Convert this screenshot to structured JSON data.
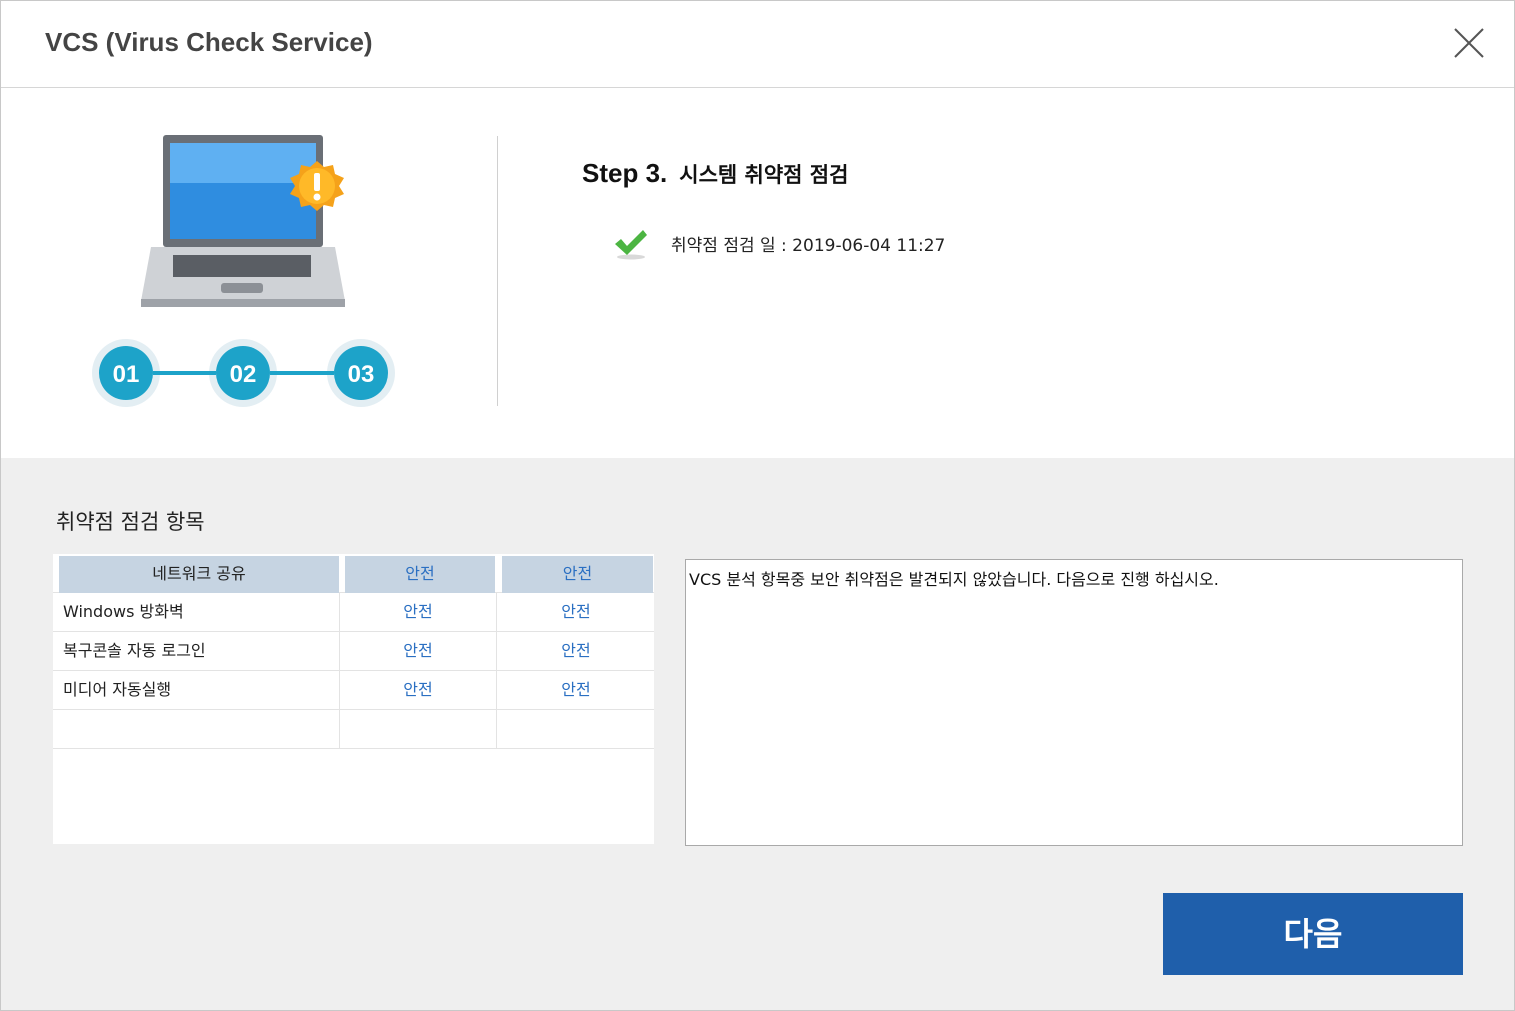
{
  "window": {
    "title": "VCS (Virus Check Service)",
    "close_icon": "close-icon"
  },
  "steps": {
    "items": [
      "01",
      "02",
      "03"
    ],
    "active_color": "#1da3c9"
  },
  "step_header": {
    "step": "Step 3.",
    "name": "시스템 취약점 점검"
  },
  "check_date": {
    "icon": "check-icon",
    "text": "취약점 점검 일 : 2019-06-04 11:27"
  },
  "section": {
    "title": "취약점 점검 항목"
  },
  "table": {
    "rows": [
      {
        "name": "네트워크 공유",
        "col1": "안전",
        "col2": "안전"
      },
      {
        "name": "Windows 방화벽",
        "col1": "안전",
        "col2": "안전"
      },
      {
        "name": "복구콘솔 자동 로그인",
        "col1": "안전",
        "col2": "안전"
      },
      {
        "name": "미디어 자동실행",
        "col1": "안전",
        "col2": "안전"
      }
    ]
  },
  "message": "VCS 분석 항목중 보안 취약점은 발견되지 않았습니다. 다음으로 진행 하십시오.",
  "buttons": {
    "next": "다음"
  },
  "colors": {
    "accent": "#1f5fab",
    "safe_text": "#2a6fc2",
    "header_bg": "#c6d4e2"
  }
}
